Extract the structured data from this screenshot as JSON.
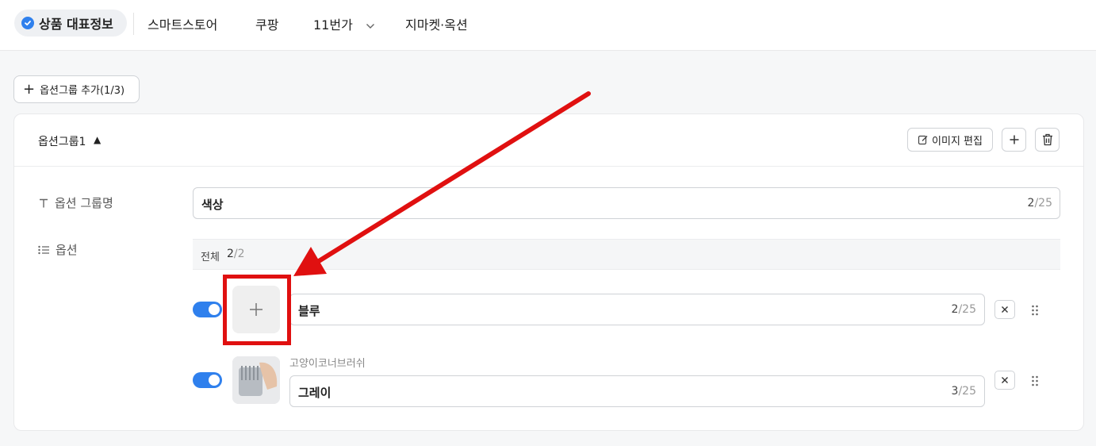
{
  "tabs": {
    "main": "상품 대표정보",
    "smartstore": "스마트스토어",
    "coupang": "쿠팡",
    "elevenst": "11번가",
    "gmarket": "지마켓·옥션"
  },
  "add_group_button": {
    "label": "옵션그룹 추가(1/3)"
  },
  "group": {
    "title": "옵션그룹1",
    "caret": "▲",
    "edit_image_label": "이미지 편집",
    "name_field": {
      "label": "옵션 그룹명",
      "value": "색상",
      "count": "2",
      "max": "/25"
    },
    "options_label": "옵션",
    "options_header": {
      "all_label": "전체",
      "count": "2",
      "total": "/2"
    },
    "options": [
      {
        "value": "블루",
        "count": "2",
        "max": "/25",
        "enabled": true,
        "image": "plus-icon"
      },
      {
        "caption": "고양이코너브러쉬",
        "value": "그레이",
        "count": "3",
        "max": "/25",
        "enabled": true,
        "image": "product-thumbnail"
      }
    ]
  },
  "colors": {
    "accent": "#2f80ed",
    "annotation": "#e01010"
  }
}
